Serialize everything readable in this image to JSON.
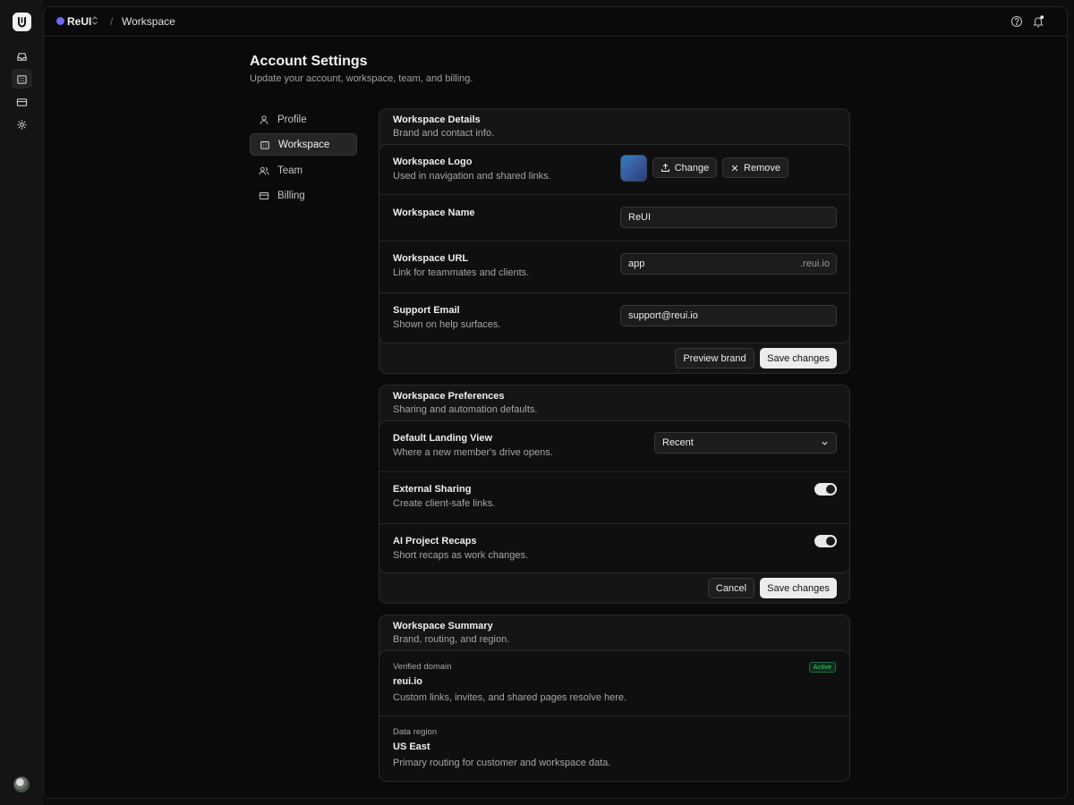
{
  "app": {
    "workspace_name": "ReUI",
    "breadcrumb_separator": "/",
    "breadcrumb_page": "Workspace",
    "accent_color": "#6c6af0"
  },
  "rail": {
    "items": [
      "inbox-icon",
      "building-icon",
      "card-icon",
      "gear-icon"
    ],
    "active": "building-icon"
  },
  "header": {
    "title": "Account Settings",
    "subtitle": "Update your account, workspace, team, and billing."
  },
  "settings_nav": {
    "items": [
      {
        "label": "Profile",
        "icon": "user-icon"
      },
      {
        "label": "Workspace",
        "icon": "building-icon",
        "active": true
      },
      {
        "label": "Team",
        "icon": "users-icon"
      },
      {
        "label": "Billing",
        "icon": "card-icon"
      }
    ]
  },
  "details": {
    "title": "Workspace Details",
    "desc": "Brand and contact info.",
    "logo": {
      "title": "Workspace Logo",
      "desc": "Used in navigation and shared links.",
      "change_label": "Change",
      "remove_label": "Remove"
    },
    "name": {
      "title": "Workspace Name",
      "value": "ReUI"
    },
    "url": {
      "title": "Workspace URL",
      "desc": "Link for teammates and clients.",
      "value": "app",
      "suffix": ".reui.io"
    },
    "email": {
      "title": "Support Email",
      "desc": "Shown on help surfaces.",
      "value": "support@reui.io"
    },
    "preview_label": "Preview brand",
    "save_label": "Save changes"
  },
  "preferences": {
    "title": "Workspace Preferences",
    "desc": "Sharing and automation defaults.",
    "landing": {
      "title": "Default Landing View",
      "desc": "Where a new member's drive opens.",
      "value": "Recent"
    },
    "sharing": {
      "title": "External Sharing",
      "desc": "Create client-safe links.",
      "enabled": true
    },
    "recaps": {
      "title": "AI Project Recaps",
      "desc": "Short recaps as work changes.",
      "enabled": true
    },
    "cancel_label": "Cancel",
    "save_label": "Save changes"
  },
  "summary": {
    "title": "Workspace Summary",
    "desc": "Brand, routing, and region.",
    "domain": {
      "label": "Verified domain",
      "value": "reui.io",
      "desc": "Custom links, invites, and shared pages resolve here.",
      "badge": "Active"
    },
    "region": {
      "label": "Data region",
      "value": "US East",
      "desc": "Primary routing for customer and workspace data."
    }
  }
}
